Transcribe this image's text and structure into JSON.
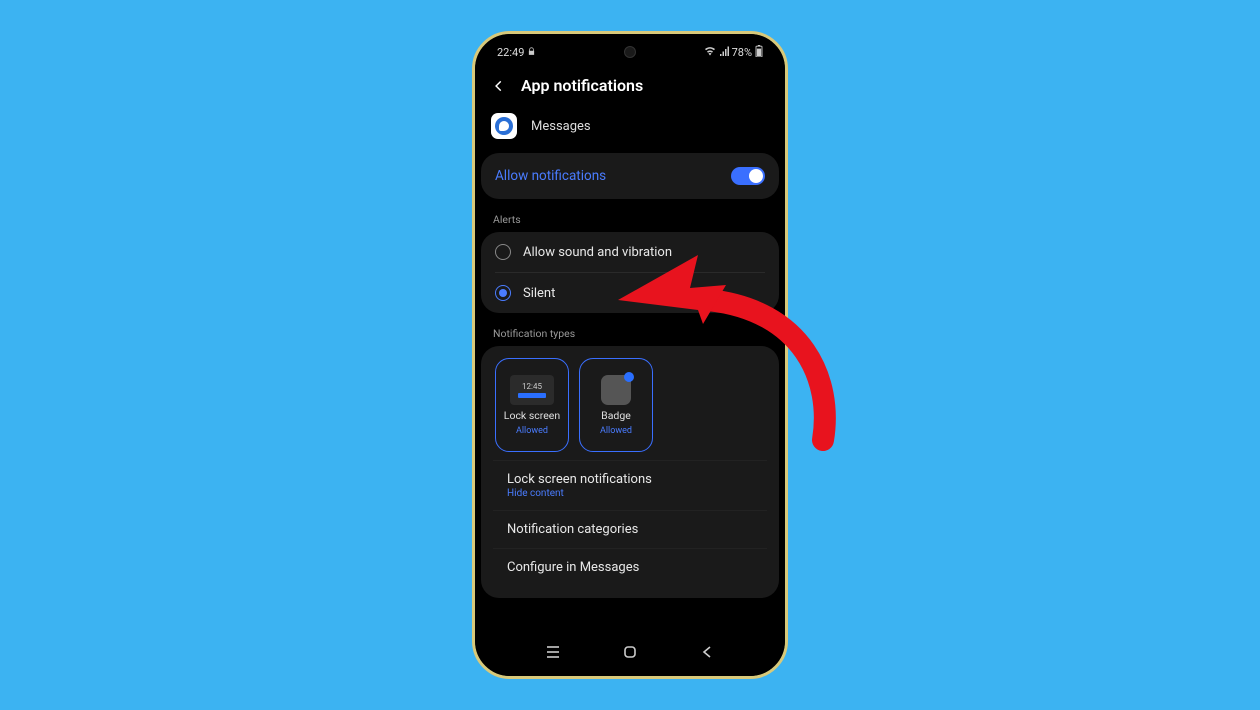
{
  "status": {
    "time": "22:49",
    "extra_icon": "lock-icon",
    "battery_pct": "78%"
  },
  "header": {
    "title": "App notifications"
  },
  "app": {
    "name": "Messages"
  },
  "allow_notifications": {
    "label": "Allow notifications",
    "enabled": true
  },
  "sections": {
    "alerts_label": "Alerts",
    "types_label": "Notification types"
  },
  "alerts": {
    "options": [
      {
        "label": "Allow sound and vibration",
        "selected": false
      },
      {
        "label": "Silent",
        "selected": true
      }
    ]
  },
  "types": {
    "tiles": [
      {
        "name": "Lock screen",
        "status": "Allowed",
        "preview_time": "12:45"
      },
      {
        "name": "Badge",
        "status": "Allowed"
      }
    ],
    "rows": [
      {
        "title": "Lock screen notifications",
        "sub": "Hide content"
      },
      {
        "title": "Notification categories",
        "sub": ""
      },
      {
        "title": "Configure in Messages",
        "sub": ""
      }
    ]
  },
  "annotation": {
    "color": "#e8131e",
    "target": "alerts.silent"
  }
}
